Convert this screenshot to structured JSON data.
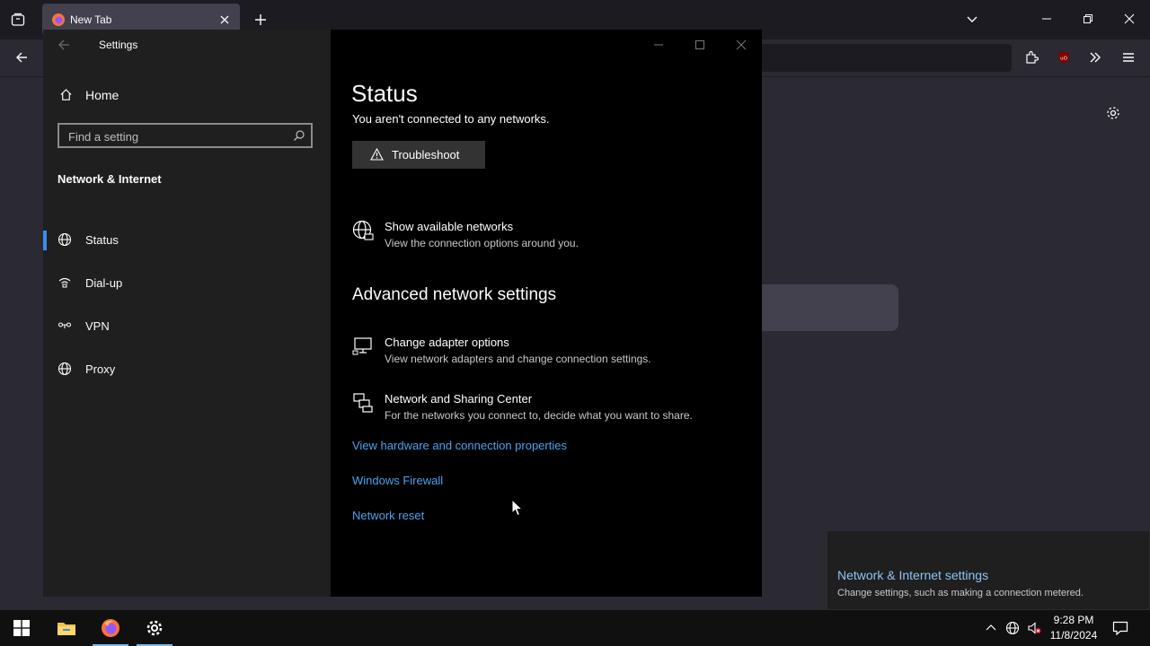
{
  "browser": {
    "tab_title": "New Tab"
  },
  "settings": {
    "app_title": "Settings",
    "home_label": "Home",
    "search_placeholder": "Find a setting",
    "section_heading": "Network & Internet",
    "nav_items": [
      {
        "label": "Status",
        "icon": "globe-status-icon",
        "active": true
      },
      {
        "label": "Dial-up",
        "icon": "dial-up-icon",
        "active": false
      },
      {
        "label": "VPN",
        "icon": "vpn-icon",
        "active": false
      },
      {
        "label": "Proxy",
        "icon": "globe-icon",
        "active": false
      }
    ],
    "page_title": "Status",
    "status_message": "You aren't connected to any networks.",
    "troubleshoot_label": "Troubleshoot",
    "show_networks": {
      "title": "Show available networks",
      "subtitle": "View the connection options around you."
    },
    "advanced_heading": "Advanced network settings",
    "adapter": {
      "title": "Change adapter options",
      "subtitle": "View network adapters and change connection settings."
    },
    "sharing": {
      "title": "Network and Sharing Center",
      "subtitle": "For the networks you connect to, decide what you want to share."
    },
    "links": [
      "View hardware and connection properties",
      "Windows Firewall",
      "Network reset"
    ]
  },
  "notification": {
    "title": "Network & Internet settings",
    "subtitle": "Change settings, such as making a connection metered."
  },
  "taskbar": {
    "time": "9:28 PM",
    "date": "11/8/2024"
  },
  "colors": {
    "accent": "#3b8eea",
    "link": "#4aa3f0"
  }
}
